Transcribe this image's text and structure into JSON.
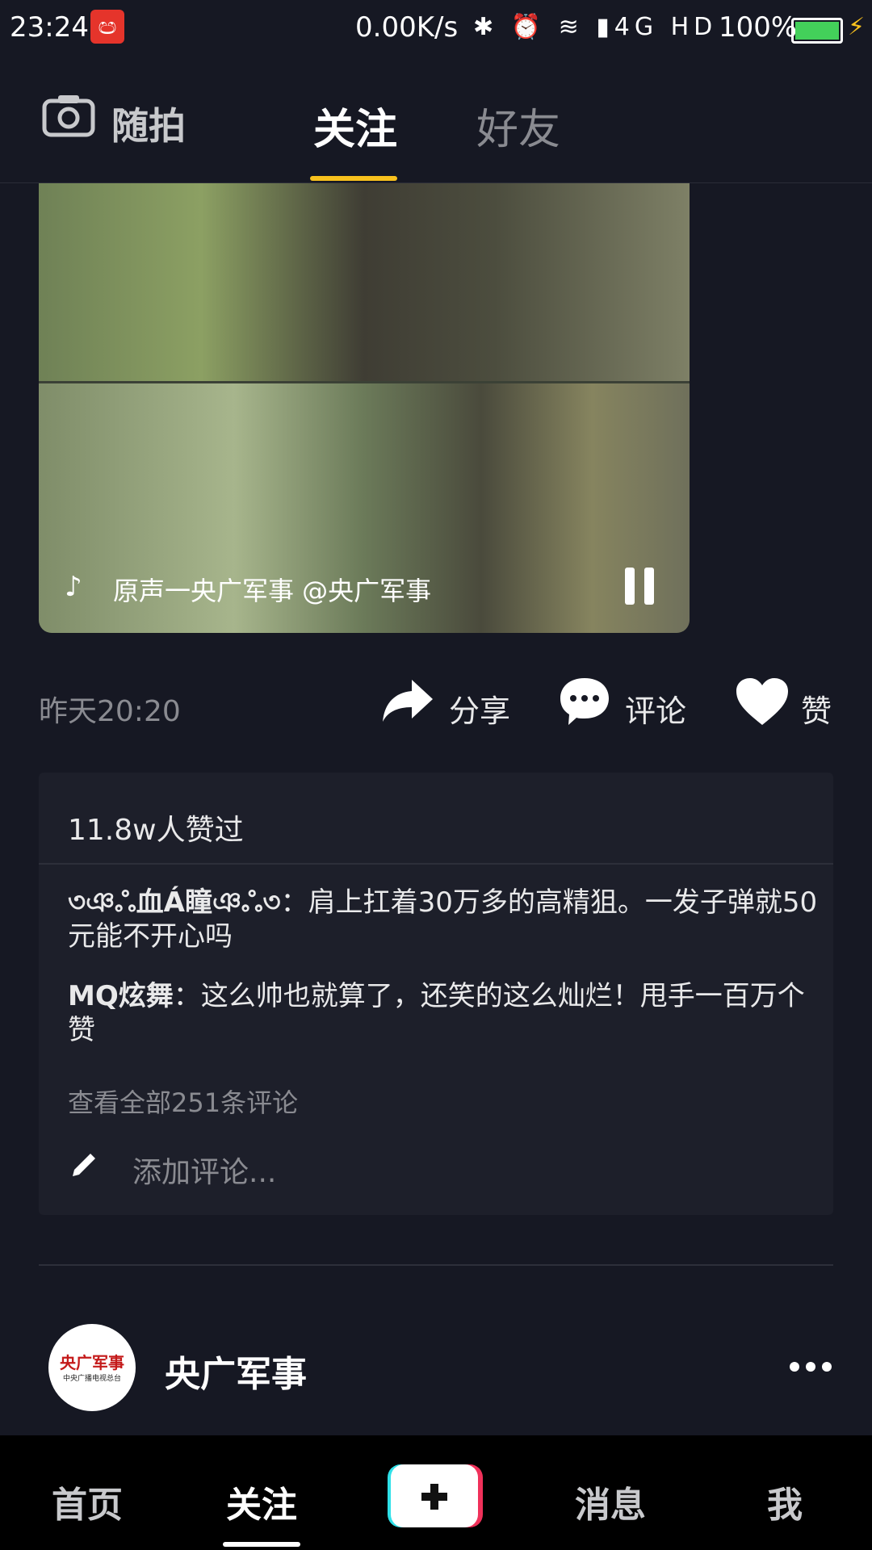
{
  "status_bar": {
    "time": "23:24",
    "app_icon_glyph": "ඏ",
    "network_speed": "0.00K/s",
    "icons": "✱ ⏰ ≋ ▮4G HD",
    "battery": "100%",
    "battery_level": 1.0,
    "battery_color": "#43d05a"
  },
  "header": {
    "camera_label": "随拍",
    "tabs": [
      {
        "label": "关注",
        "active": true
      },
      {
        "label": "好友",
        "active": false
      }
    ],
    "accent_color": "#f8c11d"
  },
  "post": {
    "music": "原声一央广军事  @央广军事",
    "time": "昨天20:20",
    "share_label": "分享",
    "comment_label": "评论",
    "like_label": "赞",
    "likes_summary": "11.8w人赞过",
    "comments": [
      {
        "user": "৩ঞஃ血Á瞳ঞஃ৩",
        "text": "：肩上扛着30万多的高精狙。一发子弹就50元能不开心吗"
      },
      {
        "user": "MQ炫舞",
        "text": "：这么帅也就算了，还笑的这么灿烂！甩手一百万个赞"
      }
    ],
    "view_all": "查看全部251条评论",
    "add_comment_placeholder": "添加评论..."
  },
  "next_post": {
    "avatar_text": "央广军事",
    "avatar_subtext": "中央广播电视总台",
    "author": "央广军事"
  },
  "bottom_nav": {
    "items": [
      "首页",
      "关注",
      "消息",
      "我"
    ],
    "plus": "+"
  }
}
